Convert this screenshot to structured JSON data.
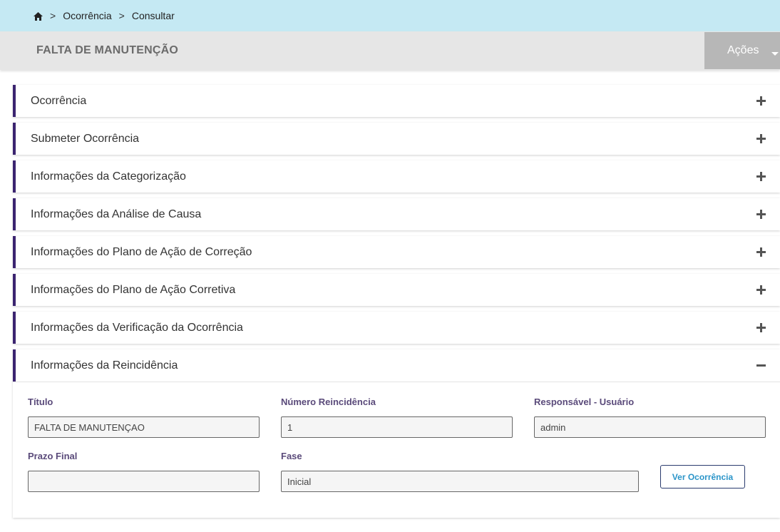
{
  "breadcrumb": {
    "home_icon": "home-icon",
    "separator": ">",
    "items": [
      "Ocorrência",
      "Consultar"
    ]
  },
  "header": {
    "title": "FALTA DE MANUTENÇÃO",
    "actions_label": "Ações"
  },
  "panels": [
    {
      "title": "Ocorrência",
      "state": "collapsed"
    },
    {
      "title": "Submeter Ocorrência",
      "state": "collapsed"
    },
    {
      "title": "Informações da Categorização",
      "state": "collapsed"
    },
    {
      "title": "Informações da Análise de Causa",
      "state": "collapsed"
    },
    {
      "title": "Informações do Plano de Ação de Correção",
      "state": "collapsed"
    },
    {
      "title": "Informações do Plano de Ação Corretiva",
      "state": "collapsed"
    },
    {
      "title": "Informações da Verificação da Ocorrência",
      "state": "collapsed"
    },
    {
      "title": "Informações da Reincidência",
      "state": "expanded"
    }
  ],
  "reincidencia": {
    "titulo_label": "Título",
    "titulo_value": "FALTA DE MANUTENÇAO",
    "numero_label": "Número Reincidência",
    "numero_value": "1",
    "responsavel_label": "Responsável - Usuário",
    "responsavel_value": "admin",
    "prazo_label": "Prazo Final",
    "prazo_value": "",
    "fase_label": "Fase",
    "fase_value": "Inicial",
    "ver_button": "Ver Ocorrência"
  },
  "colors": {
    "breadcrumb_bg": "#c5e9f3",
    "header_bg": "#e6e6e6",
    "actions_bg": "#b7b7b7",
    "panel_accent": "#3b2470",
    "label_color": "#5a4a7a",
    "link_color": "#2b95c9"
  }
}
